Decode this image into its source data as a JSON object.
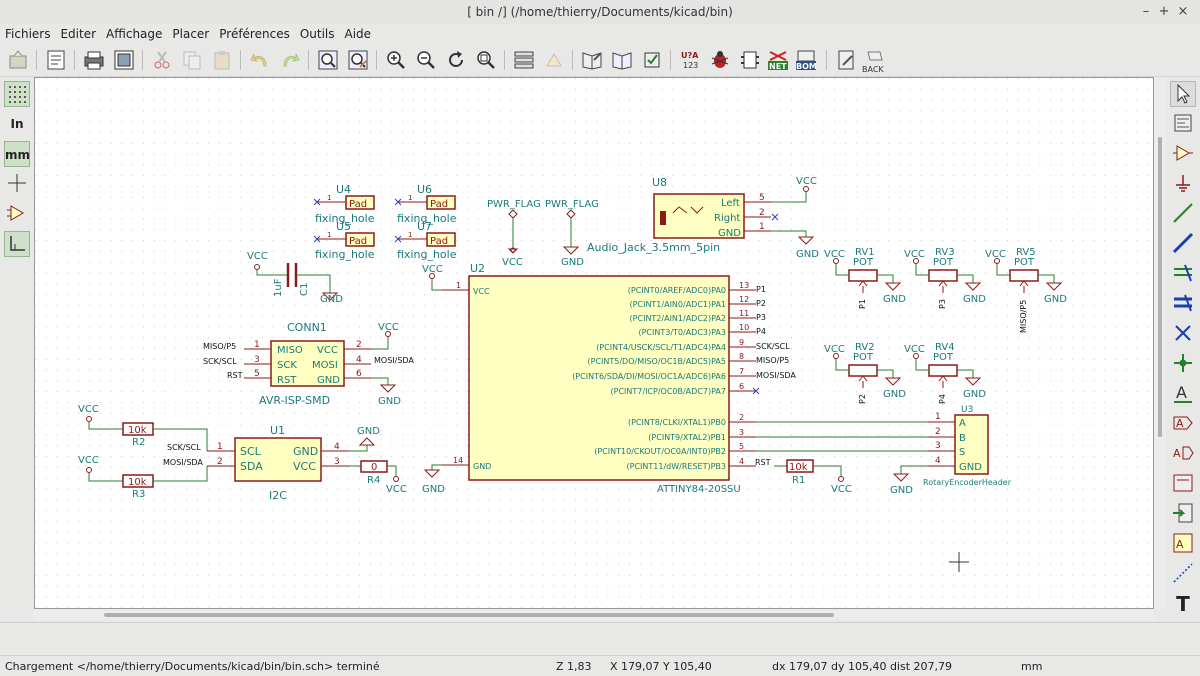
{
  "window": {
    "title": "[ bin /] (/home/thierry/Documents/kicad/bin)",
    "controls": {
      "minimize": "–",
      "maximize": "+",
      "close": "×"
    }
  },
  "menu": [
    "Fichiers",
    "Editer",
    "Affichage",
    "Placer",
    "Préférences",
    "Outils",
    "Aide"
  ],
  "toolbar": {
    "back_label": "BACK",
    "net_label": "NET",
    "bom_label": "BOM",
    "annotate_label": "U?A 123"
  },
  "left_toolbar": {
    "inch_label": "In",
    "mm_label": "mm"
  },
  "right_toolbar": {
    "text_label": "T",
    "label_glyph": "A"
  },
  "colors": {
    "wire": "#2a7f2a",
    "component": "#8b1a1a",
    "body_fill": "#ffffc2",
    "label_text": "#1a7a7a",
    "pin_text": "#8b1a1a",
    "grid": "#c8c8c8"
  },
  "schematic": {
    "u4": {
      "ref": "U4",
      "value": "fixing_hole",
      "pad": "Pad",
      "pin": "1"
    },
    "u6": {
      "ref": "U6",
      "value": "fixing_hole",
      "pad": "Pad",
      "pin": "1"
    },
    "u5": {
      "ref": "U5",
      "value": "fixing_hole",
      "pad": "Pad",
      "pin": "1"
    },
    "u7": {
      "ref": "U7",
      "value": "fixing_hole",
      "pad": "Pad",
      "pin": "1"
    },
    "pwr_flag_1": {
      "label": "PWR_FLAG",
      "net": "VCC"
    },
    "pwr_flag_2": {
      "label": "PWR_FLAG",
      "net": "GND"
    },
    "u8": {
      "ref": "U8",
      "value": "Audio_Jack_3.5mm_5pin",
      "pins": [
        "Left",
        "Right",
        "GND"
      ],
      "pin_numbers": [
        "5",
        "2",
        "1"
      ],
      "vcc": "VCC",
      "gnd": "GND"
    },
    "c1": {
      "ref": "C1",
      "value": "1uF",
      "vcc": "VCC",
      "gnd": "GND"
    },
    "conn1": {
      "ref": "CONN1",
      "value": "AVR-ISP-SMD",
      "left_pins": [
        {
          "num": "1",
          "name": "MISO",
          "net": "MISO/P5"
        },
        {
          "num": "3",
          "name": "SCK",
          "net": "SCK/SCL"
        },
        {
          "num": "5",
          "name": "RST",
          "net": "RST"
        }
      ],
      "right_pins": [
        {
          "num": "2",
          "name": "VCC",
          "net": "VCC"
        },
        {
          "num": "4",
          "name": "MOSI",
          "net": "MOSI/SDA"
        },
        {
          "num": "6",
          "name": "GND",
          "net": "GND"
        }
      ]
    },
    "u2": {
      "ref": "U2",
      "value": "ATTINY84-20SSU",
      "vcc_pin": {
        "num": "1",
        "name": "VCC",
        "net": "VCC"
      },
      "gnd_pin": {
        "num": "14",
        "name": "GND",
        "net": "GND"
      },
      "right_pins": [
        {
          "num": "13",
          "name": "(PCINT0/AREF/ADC0)PA0",
          "net": "P1"
        },
        {
          "num": "12",
          "name": "(PCINT1/AIN0/ADC1)PA1",
          "net": "P2"
        },
        {
          "num": "11",
          "name": "(PCINT2/AIN1/ADC2)PA2",
          "net": "P3"
        },
        {
          "num": "10",
          "name": "(PCINT3/T0/ADC3)PA3",
          "net": "P4"
        },
        {
          "num": "9",
          "name": "(PCINT4/USCK/SCL/T1/ADC4)PA4",
          "net": "SCK/SCL"
        },
        {
          "num": "8",
          "name": "(PCINT5/DO/MISO/OC1B/ADC5)PA5",
          "net": "MISO/P5"
        },
        {
          "num": "7",
          "name": "(PCINT6/SDA/DI/MOSI/OC1A/ADC6)PA6",
          "net": "MOSI/SDA"
        },
        {
          "num": "6",
          "name": "(PCINT7/ICP/OC0B/ADC7)PA7",
          "net": ""
        },
        {
          "num": "2",
          "name": "(PCINT8/CLKI/XTAL1)PB0",
          "net": ""
        },
        {
          "num": "3",
          "name": "(PCINT9/XTAL2)PB1",
          "net": ""
        },
        {
          "num": "5",
          "name": "(PCINT10/CKOUT/OC0A/INT0)PB2",
          "net": ""
        },
        {
          "num": "4",
          "name": "(PCINT11/dW/RESET)PB3",
          "net": "RST"
        }
      ]
    },
    "rv1": {
      "ref": "RV1",
      "value": "POT",
      "vcc": "VCC",
      "gnd": "GND",
      "net": "P1"
    },
    "rv3": {
      "ref": "RV3",
      "value": "POT",
      "vcc": "VCC",
      "gnd": "GND",
      "net": "P3"
    },
    "rv5": {
      "ref": "RV5",
      "value": "POT",
      "vcc": "VCC",
      "gnd": "GND",
      "net": "MISO/P5"
    },
    "rv2": {
      "ref": "RV2",
      "value": "POT",
      "vcc": "VCC",
      "gnd": "GND",
      "net": "P2"
    },
    "rv4": {
      "ref": "RV4",
      "value": "POT",
      "vcc": "VCC",
      "gnd": "GND",
      "net": "P4"
    },
    "u3": {
      "ref": "U3",
      "value": "RotaryEncoderHeader",
      "gnd": "GND",
      "pins": [
        {
          "num": "1",
          "name": "A"
        },
        {
          "num": "2",
          "name": "B"
        },
        {
          "num": "3",
          "name": "S"
        },
        {
          "num": "4",
          "name": "GND"
        }
      ]
    },
    "r1": {
      "ref": "R1",
      "value": "10k",
      "net": "RST",
      "vcc": "VCC"
    },
    "r2": {
      "ref": "R2",
      "value": "10k",
      "vcc": "VCC"
    },
    "r3": {
      "ref": "R3",
      "value": "10k",
      "vcc": "VCC"
    },
    "r4": {
      "ref": "R4",
      "value": "0",
      "vcc": "VCC"
    },
    "u1": {
      "ref": "U1",
      "value": "I2C",
      "gnd_net": "GND",
      "left_pins": [
        {
          "num": "1",
          "name": "SCL",
          "net": "SCK/SCL"
        },
        {
          "num": "2",
          "name": "SDA",
          "net": "MOSI/SDA"
        }
      ],
      "right_pins": [
        {
          "num": "4",
          "name": "GND"
        },
        {
          "num": "3",
          "name": "VCC"
        }
      ]
    }
  },
  "status": {
    "message": "Chargement </home/thierry/Documents/kicad/bin/bin.sch> terminé",
    "zoom": "Z 1,83",
    "xy": "X 179,07  Y 105,40",
    "delta": "dx 179,07  dy 105,40  dist 207,79",
    "units": "mm"
  }
}
